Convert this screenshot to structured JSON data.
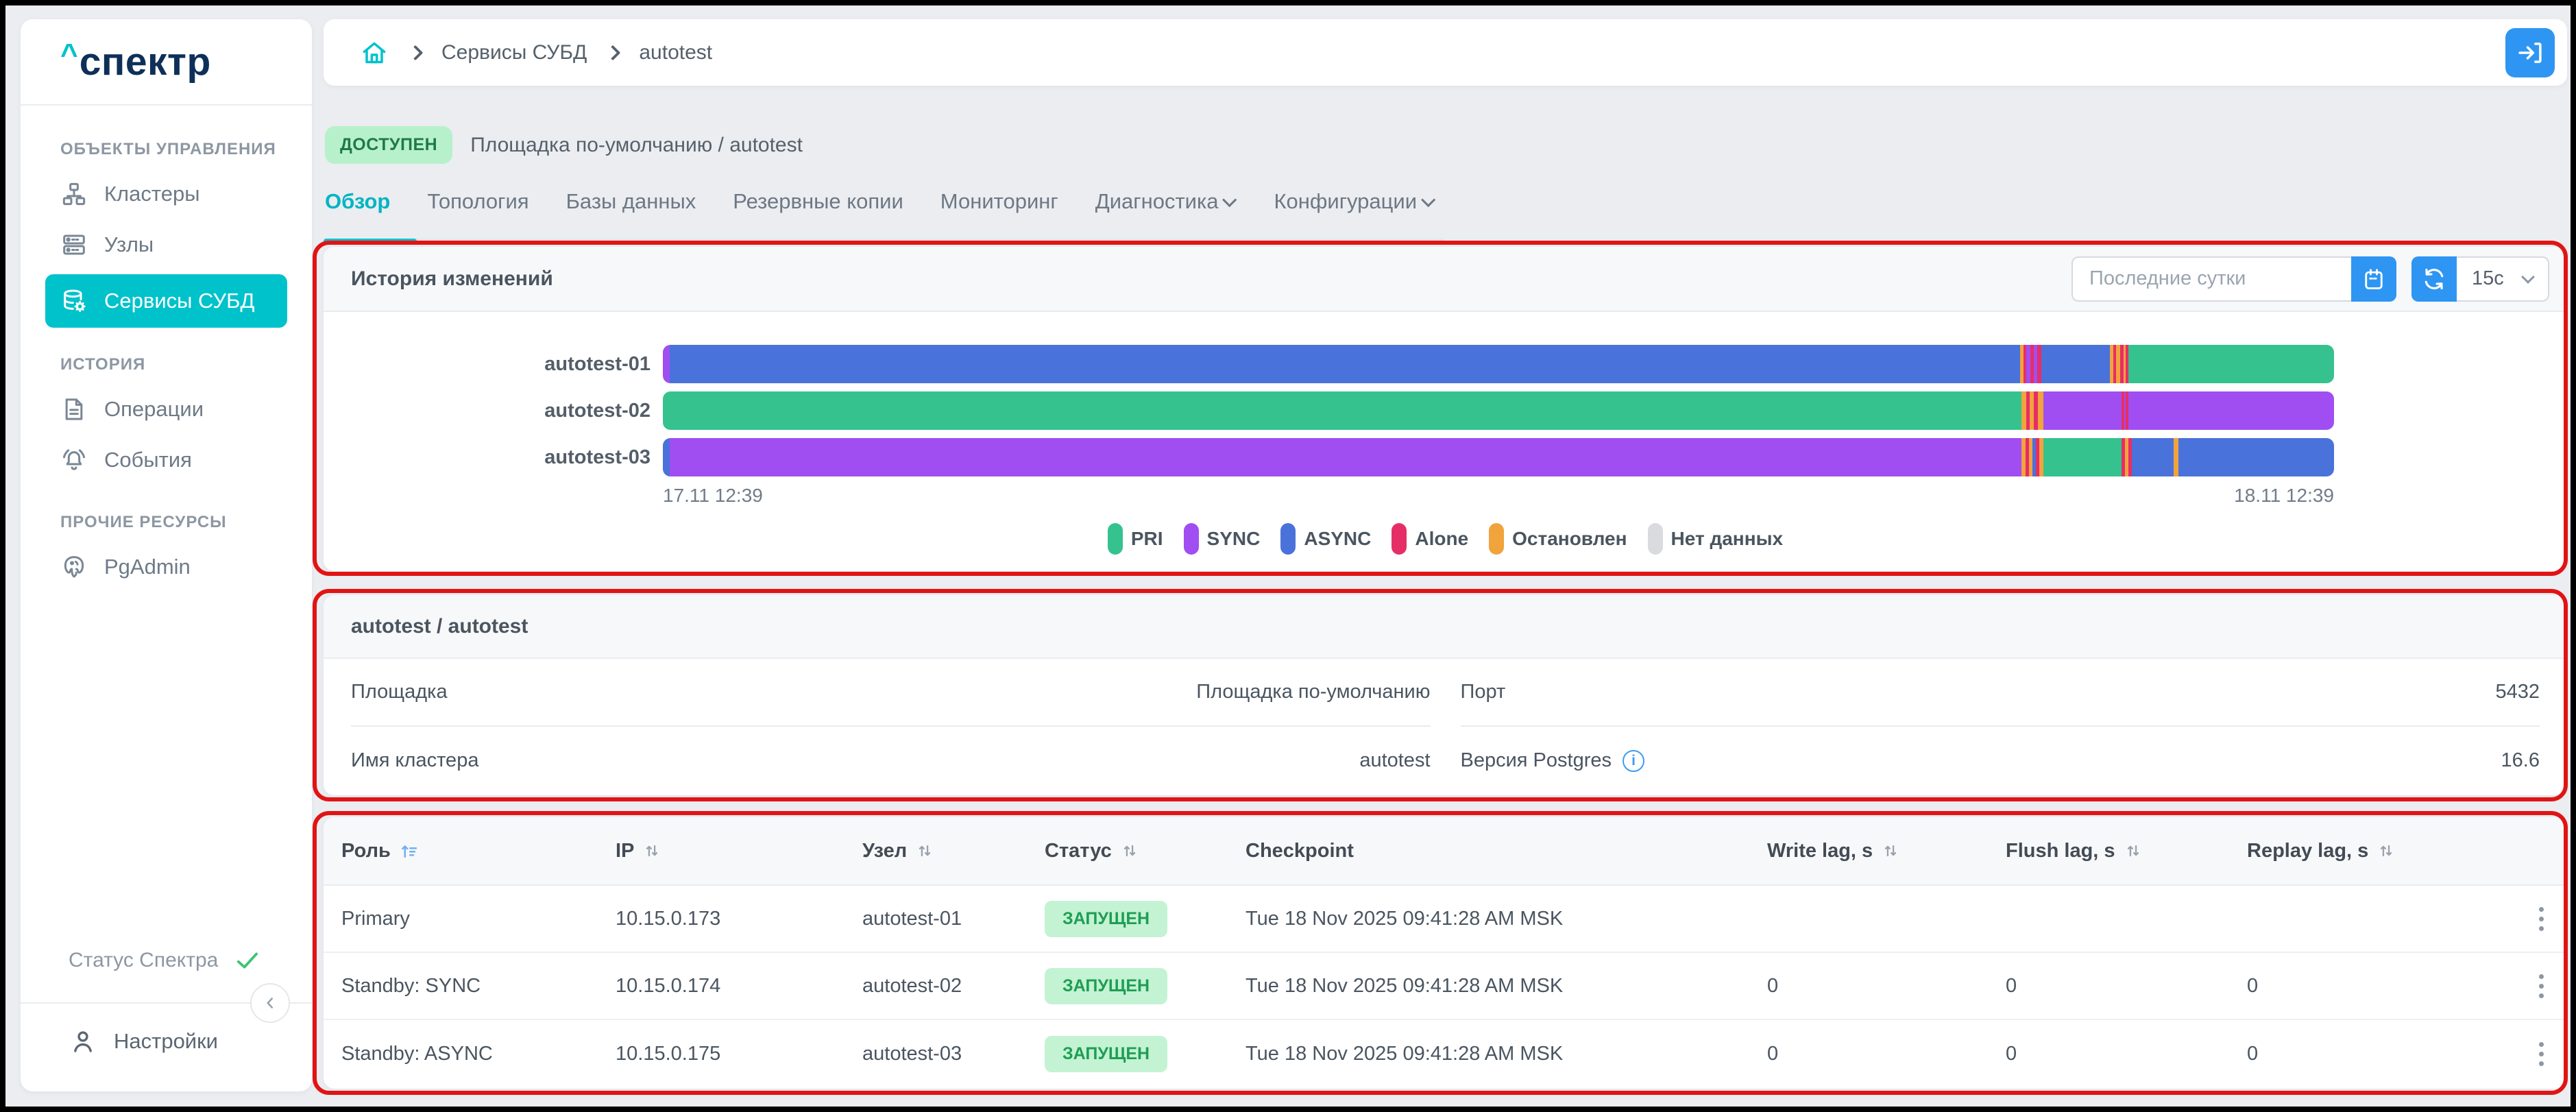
{
  "colors": {
    "accent_teal": "#00c2cb",
    "accent_blue": "#2e96f2",
    "logo_navy": "#0e3058",
    "annotation_red": "#e11414",
    "badge_green_bg": "#b7f1cb",
    "badge_green_text": "#1f7a47"
  },
  "sidebar": {
    "logo_caret": "^",
    "logo_text": "спектр",
    "sections": [
      {
        "label": "ОБЪЕКТЫ УПРАВЛЕНИЯ",
        "items": [
          {
            "label": "Кластеры",
            "icon": "clusters-icon",
            "active": false
          },
          {
            "label": "Узлы",
            "icon": "nodes-icon",
            "active": false
          },
          {
            "label": "Сервисы СУБД",
            "icon": "db-service-icon",
            "active": true
          }
        ]
      },
      {
        "label": "ИСТОРИЯ",
        "items": [
          {
            "label": "Операции",
            "icon": "operations-icon",
            "active": false
          },
          {
            "label": "События",
            "icon": "events-icon",
            "active": false
          }
        ]
      },
      {
        "label": "ПРОЧИЕ РЕСУРСЫ",
        "items": [
          {
            "label": "PgAdmin",
            "icon": "pgadmin-icon",
            "active": false
          }
        ]
      }
    ],
    "status_label": "Статус Спектра",
    "settings_label": "Настройки"
  },
  "breadcrumb": {
    "items": [
      "Сервисы СУБД",
      "autotest"
    ]
  },
  "page": {
    "status_badge": "ДОСТУПЕН",
    "title": "Площадка по-умолчанию /  autotest",
    "tabs": [
      {
        "label": "Обзор",
        "active": true,
        "dropdown": false
      },
      {
        "label": "Топология",
        "active": false,
        "dropdown": false
      },
      {
        "label": "Базы данных",
        "active": false,
        "dropdown": false
      },
      {
        "label": "Резервные копии",
        "active": false,
        "dropdown": false
      },
      {
        "label": "Мониторинг",
        "active": false,
        "dropdown": false
      },
      {
        "label": "Диагностика",
        "active": false,
        "dropdown": true
      },
      {
        "label": "Конфигурации",
        "active": false,
        "dropdown": true
      }
    ]
  },
  "history_card": {
    "title": "История изменений",
    "range_input": "Последние сутки",
    "refresh_interval": "15с",
    "axis_start": "17.11 12:39",
    "axis_end": "18.11 12:39",
    "legend": [
      {
        "key": "PRI",
        "label": "PRI"
      },
      {
        "key": "SYNC",
        "label": "SYNC"
      },
      {
        "key": "ASYNC",
        "label": "ASYNC"
      },
      {
        "key": "ALONE",
        "label": "Alone"
      },
      {
        "key": "STOPPED",
        "label": "Остановлен"
      },
      {
        "key": "NODATA",
        "label": "Нет данных"
      }
    ],
    "chart_data": {
      "type": "timeline-bar",
      "x_start": "17.11 12:39",
      "x_end": "18.11 12:39",
      "states": {
        "PRI": "#35c28f",
        "SYNC": "#a04ef2",
        "ASYNC": "#4a72db",
        "ALONE": "#e62e66",
        "STOPPED": "#f1a33c",
        "NODATA": "#d9dbde"
      },
      "rows": [
        {
          "label": "autotest-01",
          "segments": [
            [
              "SYNC",
              0.4
            ],
            [
              "ASYNC",
              80.8
            ],
            [
              "STOPPED",
              0.2
            ],
            [
              "ALONE",
              0.2
            ],
            [
              "SYNC",
              0.25
            ],
            [
              "ALONE",
              0.2
            ],
            [
              "SYNC",
              0.2
            ],
            [
              "ALONE",
              0.25
            ],
            [
              "ASYNC",
              0.3
            ],
            [
              "ASYNC",
              3.8
            ],
            [
              "STOPPED",
              0.2
            ],
            [
              "ALONE",
              0.15
            ],
            [
              "STOPPED",
              0.25
            ],
            [
              "ALONE",
              0.2
            ],
            [
              "STOPPED",
              0.15
            ],
            [
              "ALONE",
              0.15
            ],
            [
              "PRI",
              12.3
            ]
          ]
        },
        {
          "label": "autotest-02",
          "segments": [
            [
              "PRI",
              81.3
            ],
            [
              "STOPPED",
              0.3
            ],
            [
              "ALONE",
              0.2
            ],
            [
              "STOPPED",
              0.25
            ],
            [
              "ALONE",
              0.25
            ],
            [
              "STOPPED",
              0.3
            ],
            [
              "SYNC",
              4.7
            ],
            [
              "ALONE",
              0.15
            ],
            [
              "SYNC",
              0.1
            ],
            [
              "ALONE",
              0.15
            ],
            [
              "SYNC",
              12.3
            ]
          ]
        },
        {
          "label": "autotest-03",
          "segments": [
            [
              "ASYNC",
              0.4
            ],
            [
              "SYNC",
              80.9
            ],
            [
              "STOPPED",
              0.25
            ],
            [
              "ALONE",
              0.2
            ],
            [
              "STOPPED",
              0.2
            ],
            [
              "ASYNC",
              0.2
            ],
            [
              "ALONE",
              0.2
            ],
            [
              "STOPPED",
              0.25
            ],
            [
              "PRI",
              4.7
            ],
            [
              "ALONE",
              0.2
            ],
            [
              "STOPPED",
              0.2
            ],
            [
              "ALONE",
              0.2
            ],
            [
              "ASYNC",
              2.5
            ],
            [
              "STOPPED",
              0.3
            ],
            [
              "ASYNC",
              9.3
            ]
          ]
        }
      ]
    }
  },
  "info_card": {
    "title": "autotest / autotest",
    "left_rows": [
      {
        "label": "Площадка",
        "value": "Площадка по-умолчанию"
      },
      {
        "label": "Имя кластера",
        "value": "autotest"
      }
    ],
    "right_rows": [
      {
        "label": "Порт",
        "value": "5432",
        "info": false
      },
      {
        "label": "Версия Postgres",
        "value": "16.6",
        "info": true
      }
    ]
  },
  "table_card": {
    "columns": [
      {
        "label": "Роль",
        "sort": "asc"
      },
      {
        "label": "IP",
        "sort": "both"
      },
      {
        "label": "Узел",
        "sort": "both"
      },
      {
        "label": "Статус",
        "sort": "both"
      },
      {
        "label": "Checkpoint",
        "sort": null
      },
      {
        "label": "Write lag, s",
        "sort": "both"
      },
      {
        "label": "Flush lag, s",
        "sort": "both"
      },
      {
        "label": "Replay lag, s",
        "sort": "both"
      }
    ],
    "rows": [
      {
        "role": "Primary",
        "ip": "10.15.0.173",
        "node": "autotest-01",
        "status": "ЗАПУЩЕН",
        "checkpoint": "Tue 18 Nov 2025 09:41:28 AM MSK",
        "write_lag": "",
        "flush_lag": "",
        "replay_lag": ""
      },
      {
        "role": "Standby: SYNC",
        "ip": "10.15.0.174",
        "node": "autotest-02",
        "status": "ЗАПУЩЕН",
        "checkpoint": "Tue 18 Nov 2025 09:41:28 AM MSK",
        "write_lag": "0",
        "flush_lag": "0",
        "replay_lag": "0"
      },
      {
        "role": "Standby: ASYNC",
        "ip": "10.15.0.175",
        "node": "autotest-03",
        "status": "ЗАПУЩЕН",
        "checkpoint": "Tue 18 Nov 2025 09:41:28 AM MSK",
        "write_lag": "0",
        "flush_lag": "0",
        "replay_lag": "0"
      }
    ]
  }
}
